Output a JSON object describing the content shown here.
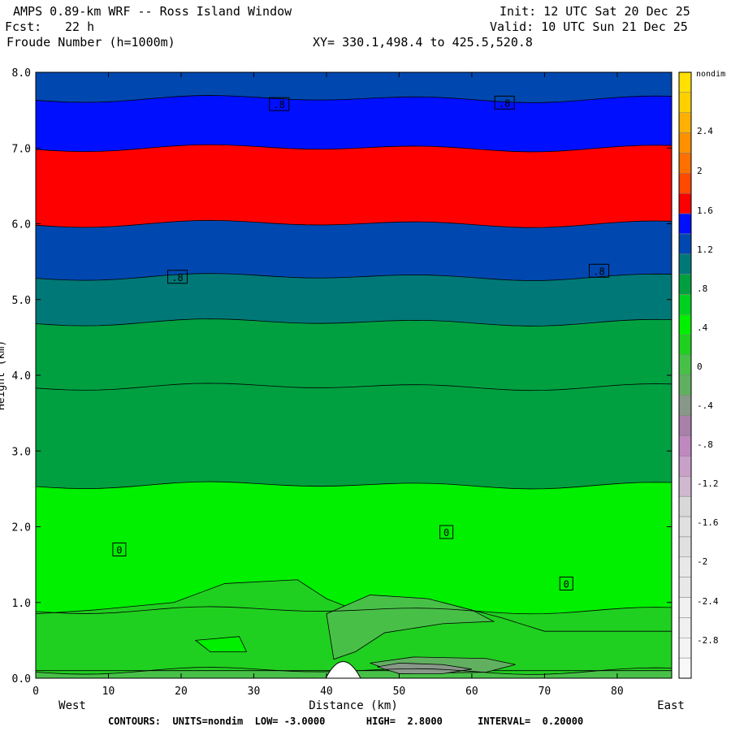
{
  "header": {
    "title": "AMPS 0.89-km WRF -- Ross Island Window",
    "fcst_label": "Fcst:",
    "fcst_value": "22 h",
    "field": "Froude Number (h=1000m)",
    "init": "Init: 12 UTC Sat 20 Dec 25",
    "valid": "Valid: 10 UTC Sun 21 Dec 25",
    "xy": "XY= 330.1,498.4 to 425.5,520.8"
  },
  "footer": {
    "contours": "CONTOURS:  UNITS=nondim  LOW= -3.0000       HIGH=  2.8000      INTERVAL=  0.20000"
  },
  "chart_data": {
    "type": "heatmap",
    "xlabel": "Distance (km)",
    "ylabel": "Height (km)",
    "x_left_label": "West",
    "x_right_label": "East",
    "xlim": [
      0,
      87.5
    ],
    "ylim": [
      0,
      8
    ],
    "xticks": [
      0,
      10,
      20,
      30,
      40,
      50,
      60,
      70,
      80
    ],
    "yticks": [
      "0.0",
      "1.0",
      "2.0",
      "3.0",
      "4.0",
      "5.0",
      "6.0",
      "7.0",
      "8.0"
    ],
    "units": "nondim",
    "contour_low": -3.0,
    "contour_high": 2.8,
    "contour_interval": 0.2,
    "colorbar": {
      "label": "nondim",
      "tick_labels": [
        "2.4",
        "2",
        "1.6",
        "1.2",
        ".8",
        ".4",
        "0",
        "-.4",
        "-.8",
        "-1.2",
        "-1.6",
        "-2",
        "-2.4",
        "-2.8"
      ],
      "colors": [
        "#ffe000",
        "#ffd000",
        "#ffb000",
        "#ff9000",
        "#ff7000",
        "#ff4800",
        "#ff0000",
        "#0010ff",
        "#0048b0",
        "#007878",
        "#00a040",
        "#00d020",
        "#00f000",
        "#20d020",
        "#48c048",
        "#60b060",
        "#889888",
        "#a880a8",
        "#c088c0",
        "#c8a0c8",
        "#d0b8d0",
        "#d8d8d8",
        "#e0e0e0",
        "#e0e0e0",
        "#e8e8e8",
        "#e8e8e8",
        "#f0f0f0",
        "#f0f0f0",
        "#f4f4f4",
        "#f8f8f8"
      ]
    },
    "bands": [
      {
        "from": 0.0,
        "to": 0.1,
        "color": "#48c048"
      },
      {
        "from": 0.1,
        "to": 0.9,
        "color": "#20d020"
      },
      {
        "from": 0.9,
        "to": 2.55,
        "color": "#00f000"
      },
      {
        "from": 2.55,
        "to": 3.85,
        "color": "#00a040"
      },
      {
        "from": 3.85,
        "to": 4.7,
        "color": "#00a040"
      },
      {
        "from": 4.7,
        "to": 5.3,
        "color": "#007878"
      },
      {
        "from": 5.3,
        "to": 6.0,
        "color": "#0048b0"
      },
      {
        "from": 6.0,
        "to": 7.0,
        "color": "#ff0000"
      },
      {
        "from": 7.0,
        "to": 7.65,
        "color": "#0010ff"
      },
      {
        "from": 7.65,
        "to": 8.0,
        "color": "#0048b0"
      }
    ],
    "contour_labels": [
      {
        "text": ".8",
        "x": 33.5,
        "y": 7.58
      },
      {
        "text": ".8",
        "x": 64.5,
        "y": 7.6
      },
      {
        "text": ".8",
        "x": 19.5,
        "y": 5.3
      },
      {
        "text": ".8",
        "x": 77.5,
        "y": 5.38
      },
      {
        "text": "0",
        "x": 11.5,
        "y": 1.7
      },
      {
        "text": "0",
        "x": 56.5,
        "y": 1.93
      },
      {
        "text": "0",
        "x": 73.0,
        "y": 1.25
      }
    ],
    "terrain_peak": {
      "x": 42.3,
      "height": 0.22
    }
  }
}
